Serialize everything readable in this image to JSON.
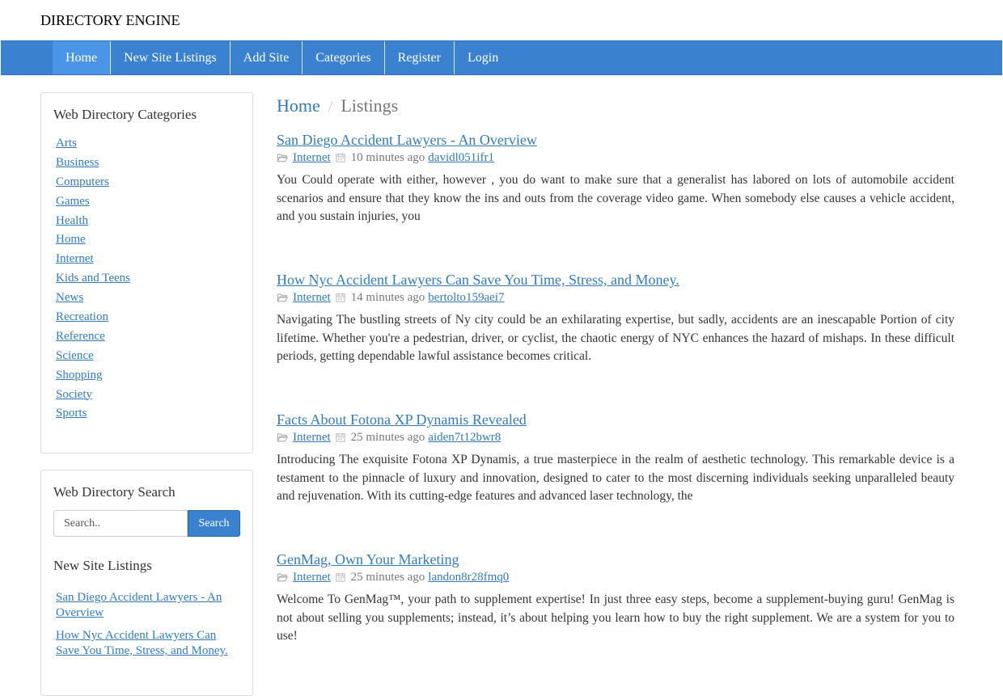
{
  "brand": "DIRECTORY ENGINE",
  "nav": {
    "items": [
      {
        "label": "Home",
        "active": true
      },
      {
        "label": "New Site Listings"
      },
      {
        "label": "Add Site"
      },
      {
        "label": "Categories"
      },
      {
        "label": "Register"
      },
      {
        "label": "Login"
      }
    ]
  },
  "sidebar": {
    "categories_title": "Web Directory Categories",
    "categories": [
      "Arts",
      "Business",
      "Computers",
      "Games",
      "Health",
      "Home",
      "Internet",
      "Kids and Teens",
      "News",
      "Recreation",
      "Reference",
      "Science",
      "Shopping",
      "Society",
      "Sports"
    ],
    "search_title": "Web Directory Search",
    "search_placeholder": "Search..",
    "search_button": "Search",
    "new_listings_title": "New Site Listings",
    "new_listings": [
      "San Diego Accident Lawyers - An Overview",
      "How Nyc Accident Lawyers Can Save You Time, Stress, and Money."
    ]
  },
  "breadcrumb": {
    "home": "Home",
    "separator": "/",
    "current": "Listings"
  },
  "listings": [
    {
      "title": "San Diego Accident Lawyers - An Overview",
      "category": "Internet",
      "time": "10 minutes ago",
      "user": "davidl051ifr1",
      "description": "You Could operate with either, however , you do want to make sure that a generalist has labored on lots of automobile accident scenarios and ensure that they know the ins and outs from the coverage video game. When somebody else causes a vehicle accident, and you sustain injuries, you"
    },
    {
      "title": "How Nyc Accident Lawyers Can Save You Time, Stress, and Money.",
      "category": "Internet",
      "time": "14 minutes ago",
      "user": "bertolto159aei7",
      "description": "Navigating The bustling streets of Ny city could be an exhilarating expertise, but sadly, accidents are an inescapable Portion of city lifetime. Whether you're a pedestrian, driver, or cyclist, the chaotic energy of NYC enhances the hazard of mishaps. In these difficult periods, getting dependable lawful assistance becomes critical."
    },
    {
      "title": "Facts About Fotona XP Dynamis Revealed",
      "category": "Internet",
      "time": "25 minutes ago",
      "user": "aiden7t12bwr8",
      "description": "Introducing The exquisite Fotona XP Dynamis, a true masterpiece in the realm of aesthetic technology. This remarkable device is a testament to the pinnacle of luxury and innovation, designed to cater to the most discerning individuals seeking unparalleled beauty and rejuvenation. With its cutting-edge features and advanced laser technology, the"
    },
    {
      "title": "GenMag, Own Your Marketing",
      "category": "Internet",
      "time": "25 minutes ago",
      "user": "landon8r28fmq0",
      "description": "Welcome To GenMag™, your path to supplement expertise! In just three easy steps, become a supplement-buying guru! GenMag is not about selling you supplements; instead, it’s about helping you learn how to buy the right supplement. We are a system for you to use!"
    }
  ],
  "icons": {
    "category": "folder-open-icon",
    "date": "calendar-icon"
  },
  "colors": {
    "nav_bg": "#3a82d0",
    "link": "#337ab7",
    "muted": "#777777"
  }
}
